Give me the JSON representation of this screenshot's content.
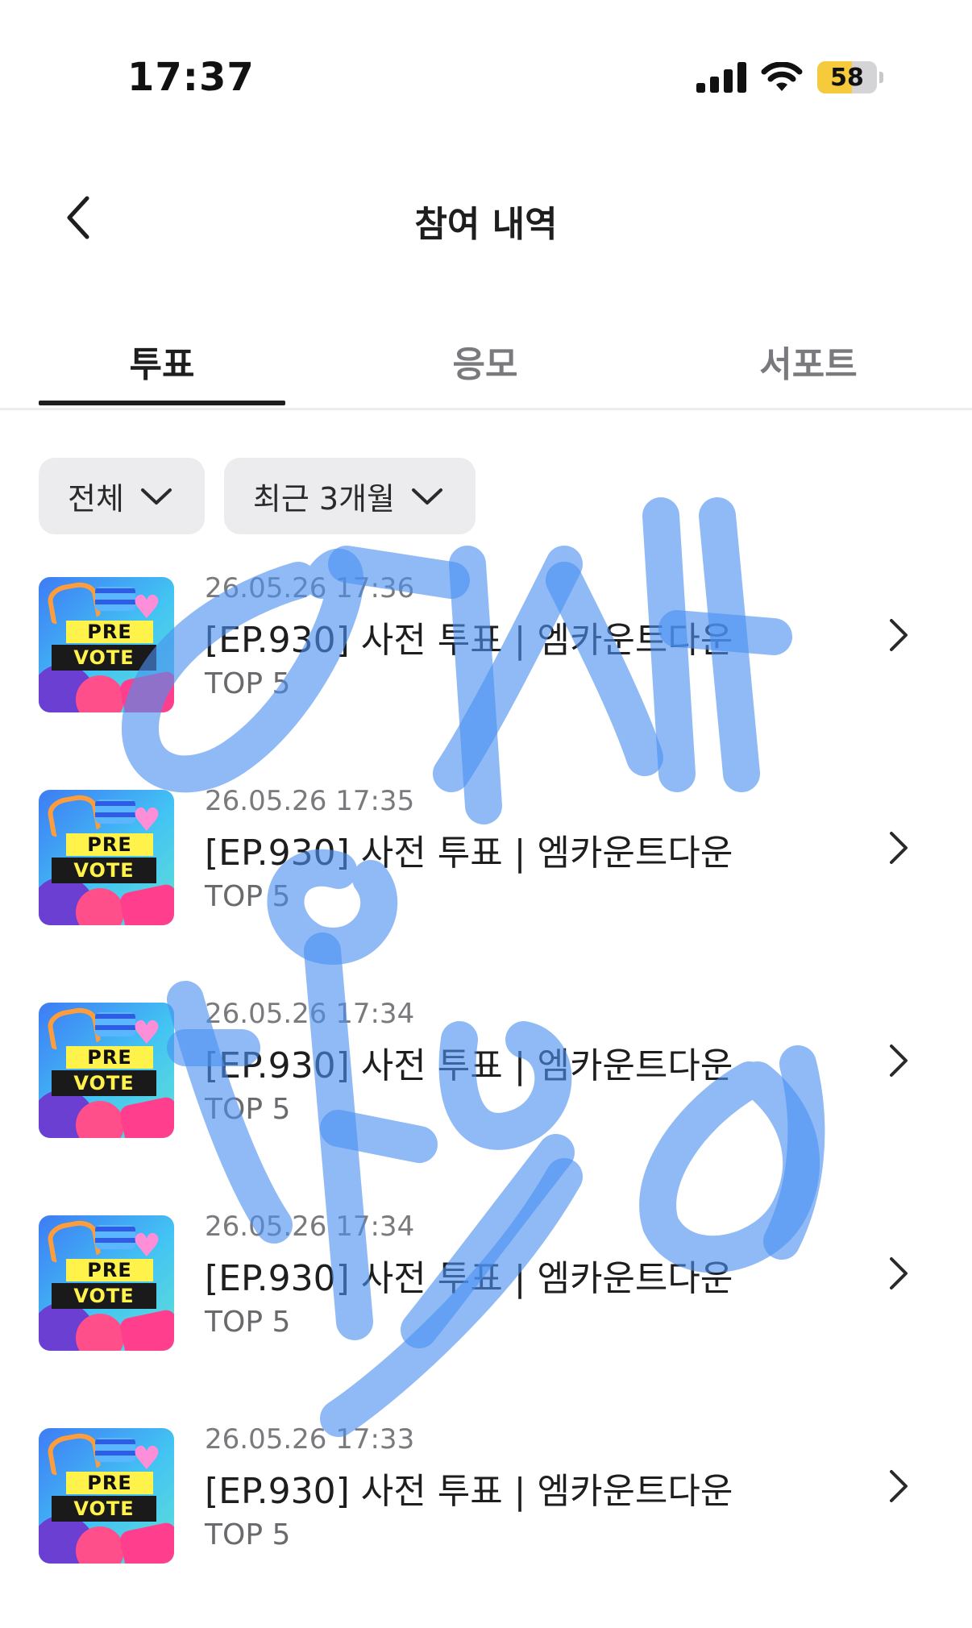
{
  "status_bar": {
    "time": "17:37",
    "battery_text": "58",
    "battery_level": 0.58
  },
  "header": {
    "title": "참여 내역",
    "back_icon": "chevron-left-icon"
  },
  "tabs": [
    {
      "label": "투표",
      "active": true
    },
    {
      "label": "응모",
      "active": false
    },
    {
      "label": "서포트",
      "active": false
    }
  ],
  "filters": {
    "category": "전체",
    "period": "최근 3개월"
  },
  "items": [
    {
      "date": "26.05.26 17:36",
      "title": "[EP.930] 사전 투표 | 엠카운트다운",
      "subtitle": "TOP 5",
      "thumb_top": "PRE",
      "thumb_bottom": "VOTE"
    },
    {
      "date": "26.05.26 17:35",
      "title": "[EP.930] 사전 투표 | 엠카운트다운",
      "subtitle": "TOP 5",
      "thumb_top": "PRE",
      "thumb_bottom": "VOTE"
    },
    {
      "date": "26.05.26 17:34",
      "title": "[EP.930] 사전 투표 | 엠카운트다운",
      "subtitle": "TOP 5",
      "thumb_top": "PRE",
      "thumb_bottom": "VOTE"
    },
    {
      "date": "26.05.26 17:34",
      "title": "[EP.930] 사전 투표 | 엠카운트다운",
      "subtitle": "TOP 5",
      "thumb_top": "PRE",
      "thumb_bottom": "VOTE"
    },
    {
      "date": "26.05.26 17:33",
      "title": "[EP.930] 사전 투표 | 엠카운트다운",
      "subtitle": "TOP 5",
      "thumb_top": "PRE",
      "thumb_bottom": "VOTE"
    }
  ],
  "colors": {
    "active_tab": "#1e1e1e",
    "inactive_tab": "#7a7a7e",
    "chip_bg": "#ececee",
    "battery_fill": "#f5cb3d",
    "scribble": "#4a8ff0"
  }
}
